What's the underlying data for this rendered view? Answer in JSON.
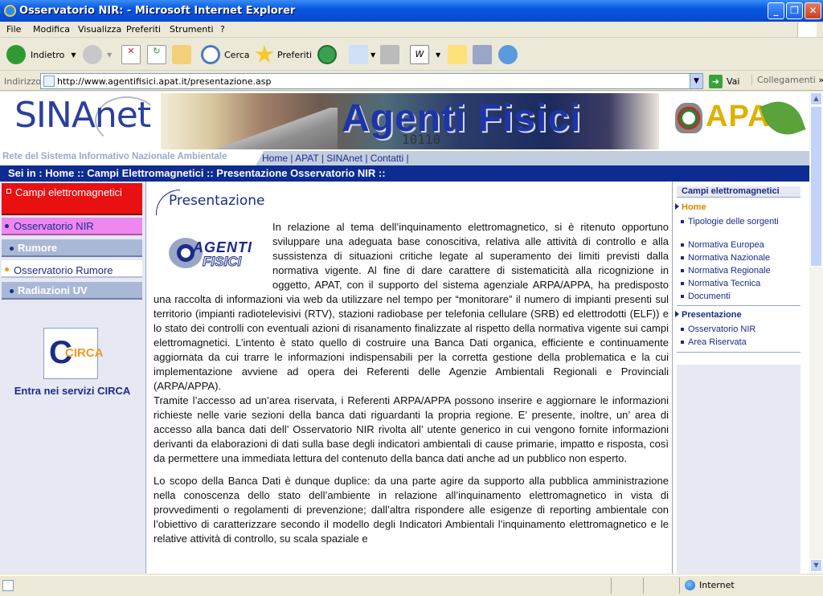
{
  "window": {
    "title": "Osservatorio NIR: - Microsoft Internet Explorer"
  },
  "menu": [
    "File",
    "Modifica",
    "Visualizza",
    "Preferiti",
    "Strumenti",
    "?"
  ],
  "toolbar": {
    "back": "Indietro",
    "search": "Cerca",
    "favorites": "Preferiti"
  },
  "address": {
    "label": "Indirizzo",
    "url": "http://www.agentifisici.apat.it/presentazione.asp",
    "go": "Vai",
    "links": "Collegamenti"
  },
  "banner": {
    "logo_left": "SINAnet",
    "logo_center": "Agenti Fisici",
    "binary": "10110",
    "logo_right": "APAT",
    "tagline": "Rete del Sistema Informativo Nazionale Ambientale"
  },
  "topnav": [
    "Home",
    "APAT",
    "SINAnet",
    "Contatti"
  ],
  "breadcrumb": "Sei in : Home :: Campi Elettromagnetici :: Presentazione Osservatorio NIR ::",
  "leftnav": {
    "items": [
      "Campi elettromagnetici",
      "Osservatorio NIR",
      "Rumore",
      "Osservatorio Rumore",
      "Radiazioni UV"
    ],
    "circa_logo": "CIRCA",
    "circa_link": "Entra nei servizi CIRCA"
  },
  "main": {
    "title": "Presentazione",
    "logo_line1": "AGENTI",
    "logo_line2": "FISICI",
    "para1": "In relazione al tema dell’inquinamento elettromagnetico, si è ritenuto opportuno sviluppare una adeguata base conoscitiva, relativa alle attività di controllo e alla sussistenza di situazioni critiche legate al superamento dei limiti previsti dalla normativa vigente. Al fine di dare carattere di sistematicità alla ricognizione in oggetto, APAT, con il supporto del sistema agenziale ARPA/APPA, ha predisposto una raccolta di informazioni via web da utilizzare nel tempo per “monitorare” il numero di impianti presenti sul territorio (impianti radiotelevisivi (RTV), stazioni radiobase per telefonia cellulare (SRB) ed elettrodotti (ELF)) e lo stato dei controlli con eventuali azioni di risanamento finalizzate al rispetto della normativa vigente sui campi elettromagnetici. L’intento è stato quello di costruire una Banca Dati organica, efficiente e continuamente aggiornata da cui trarre le informazioni indispensabili per la corretta gestione della problematica e la cui implementazione avviene ad opera dei Referenti delle Agenzie Ambientali Regionali e Provinciali (ARPA/APPA).",
    "para2": "Tramite l’accesso ad un’area riservata, i Referenti ARPA/APPA possono inserire e aggiornare le informazioni richieste nelle varie sezioni della banca dati riguardanti la propria regione. E’ presente, inoltre, un’ area di accesso alla banca dati dell’ Osservatorio NIR rivolta all’ utente generico in cui vengono fornite informazioni derivanti da elaborazioni di dati sulla base degli indicatori ambientali di cause primarie, impatto e risposta, così da permettere una immediata lettura del contenuto della banca dati anche ad un pubblico non esperto.",
    "para3": "Lo scopo della Banca Dati è dunque duplice: da una parte agire da supporto alla pubblica amministrazione nella conoscenza dello stato dell’ambiente in relazione all’inquinamento elettromagnetico in vista di provvedimenti o regolamenti di prevenzione; dall’altra rispondere alle esigenze di reporting ambientale con l’obiettivo di caratterizzare secondo il modello degli Indicatori Ambientali l’inquinamento elettromagnetico e le relative attività di controllo, su scala spaziale e"
  },
  "rightnav": {
    "header": "Campi elettromagnetici",
    "home": "Home",
    "home_items": [
      "Tipologie delle sorgenti",
      "Normativa Europea",
      "Normativa Nazionale",
      "Normativa Regionale",
      "Normativa Tecnica",
      "Documenti"
    ],
    "presentazione": "Presentazione",
    "pres_items": [
      "Osservatorio NIR",
      "Area Riservata"
    ]
  },
  "status": {
    "zone": "Internet"
  }
}
